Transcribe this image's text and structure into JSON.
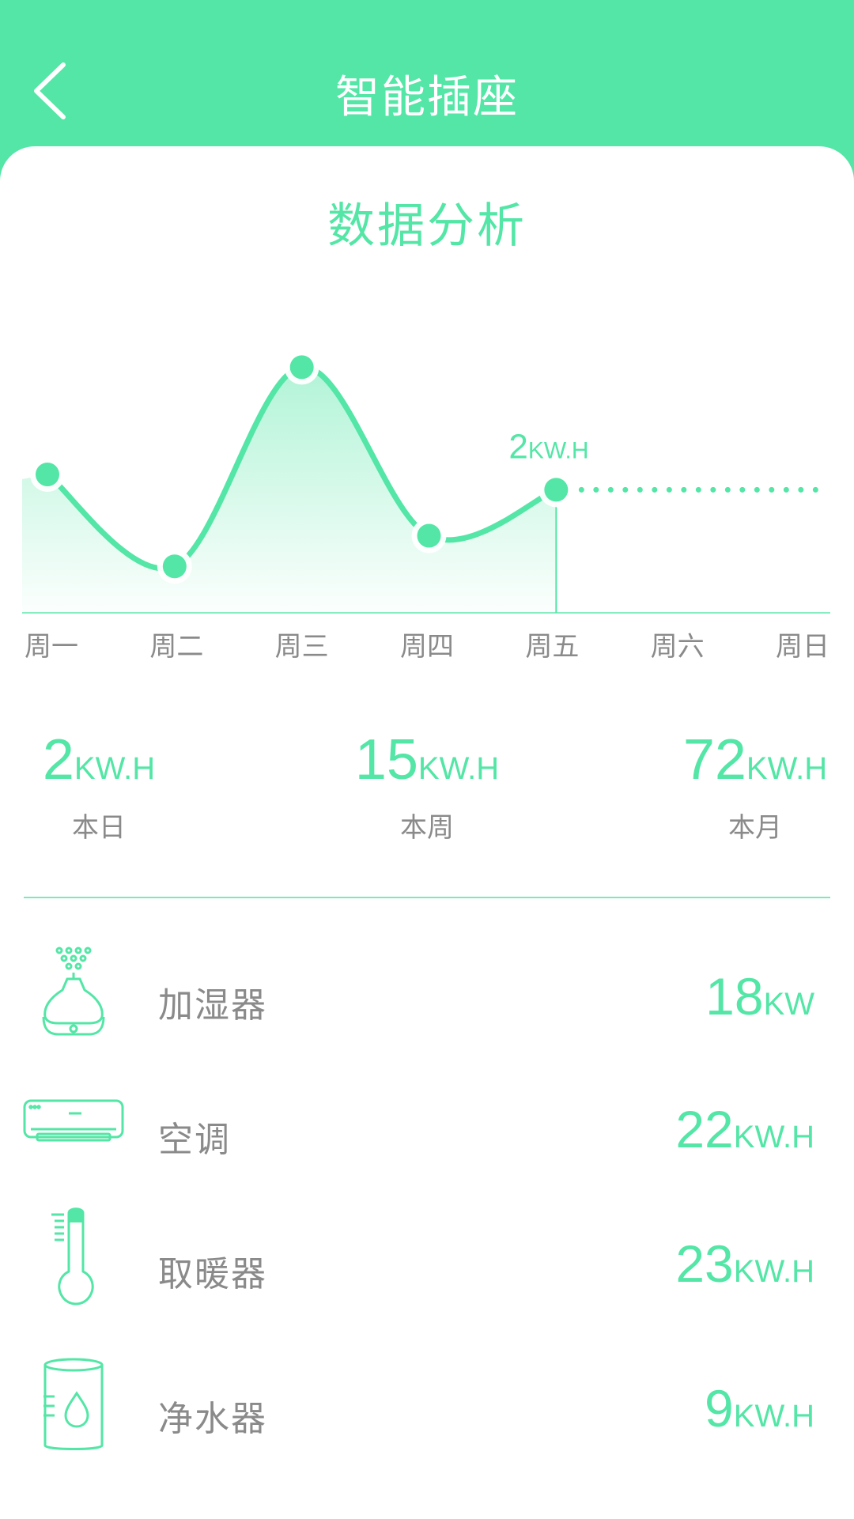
{
  "header": {
    "title": "智能插座",
    "back_icon": "chevron-left-icon"
  },
  "section": {
    "title": "数据分析"
  },
  "chart_data": {
    "type": "line",
    "categories": [
      "周一",
      "周二",
      "周三",
      "周四",
      "周五",
      "周六",
      "周日"
    ],
    "values": [
      2.2,
      1.0,
      3.6,
      1.4,
      2.0,
      null,
      null
    ],
    "highlight": {
      "category": "周五",
      "value": "2",
      "unit": "KW.H"
    },
    "color": "#53e6a6"
  },
  "stats": [
    {
      "value": "2",
      "unit": "KW.H",
      "label": "本日"
    },
    {
      "value": "15",
      "unit": "KW.H",
      "label": "本周"
    },
    {
      "value": "72",
      "unit": "KW.H",
      "label": "本月"
    }
  ],
  "devices": [
    {
      "name": "加湿器",
      "value": "18",
      "unit": "KW",
      "icon": "humidifier-icon"
    },
    {
      "name": "空调",
      "value": "22",
      "unit": "KW.H",
      "icon": "air-conditioner-icon"
    },
    {
      "name": "取暖器",
      "value": "23",
      "unit": "KW.H",
      "icon": "thermometer-icon"
    },
    {
      "name": "净水器",
      "value": "9",
      "unit": "KW.H",
      "icon": "water-purifier-icon"
    }
  ],
  "colors": {
    "accent": "#53e6a6",
    "text_gray": "#8a8a8a",
    "background": "#ffffff"
  }
}
